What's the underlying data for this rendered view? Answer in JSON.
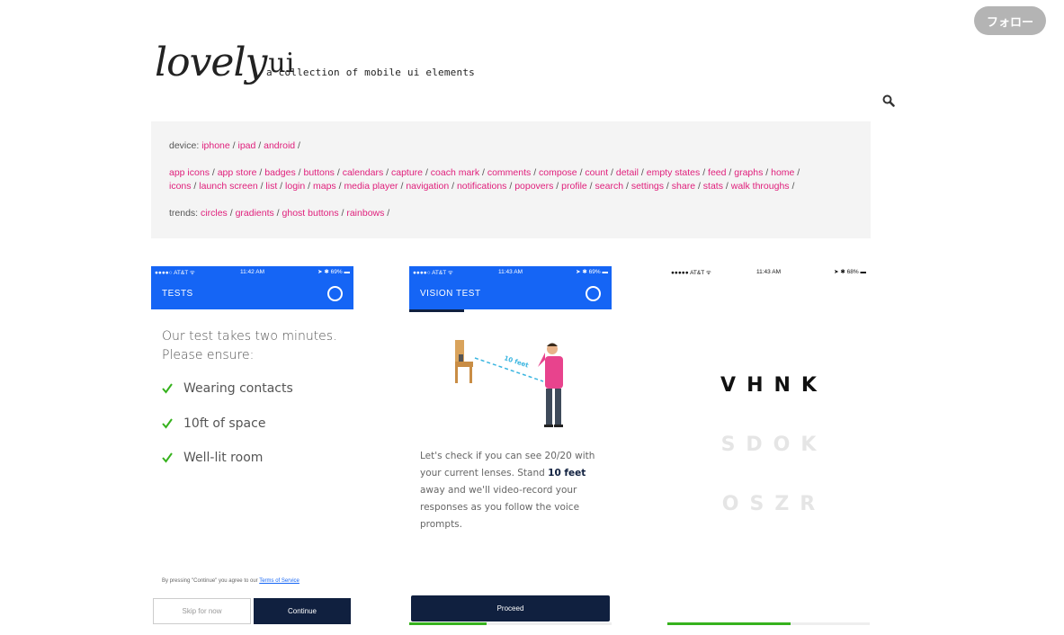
{
  "header": {
    "follow_label": "フォロー",
    "logo_lovely": "lovely",
    "logo_ui": "ui",
    "tagline": "a collection of mobile ui elements"
  },
  "filters": {
    "device_label": "device:",
    "devices": [
      "iphone",
      "ipad",
      "android"
    ],
    "categories_line1": [
      "app icons",
      "app store",
      "badges",
      "buttons",
      "calendars",
      "capture",
      "coach mark",
      "comments",
      "compose",
      "count",
      "detail",
      "empty states",
      "feed",
      "graphs",
      "home"
    ],
    "categories_line2": [
      "icons",
      "launch screen",
      "list",
      "login",
      "maps",
      "media player",
      "navigation",
      "notifications",
      "popovers",
      "profile",
      "search",
      "settings",
      "share",
      "stats",
      "walk throughs"
    ],
    "trends_label": "trends:",
    "trends": [
      "circles",
      "gradients",
      "ghost buttons",
      "rainbows"
    ]
  },
  "cards": {
    "tests": {
      "status_left": "●●●●○ AT&T ᯤ",
      "status_time": "11:42 AM",
      "status_right": "➤ ✱ 69% ▬",
      "title": "TESTS",
      "intro_line1": "Our test takes two minutes.",
      "intro_line2": "Please ensure:",
      "checklist": [
        "Wearing contacts",
        "10ft of space",
        "Well-lit room"
      ],
      "tos_prefix": "By pressing \"Continue\" you agree to our ",
      "tos_link": "Terms of Service",
      "skip_label": "Skip for now",
      "continue_label": "Continue"
    },
    "vision": {
      "status_left": "●●●●○ AT&T ᯤ",
      "status_time": "11:43 AM",
      "status_right": "➤ ✱ 69% ▬",
      "title": "VISION TEST",
      "distance_label": "10 feet",
      "text_before": "Let's check if you can see 20/20 with your current lenses. Stand ",
      "text_bold": "10 feet",
      "text_after": " away and we'll video-record your responses as you follow the voice prompts.",
      "proceed_label": "Proceed",
      "progress": 0.38
    },
    "chart": {
      "status_left": "●●●●● AT&T ᯤ",
      "status_time": "11:43 AM",
      "status_right": "➤ ✱ 68% ▬",
      "row1": "VHNK",
      "row2": "SDOK",
      "row3": "OSZR",
      "progress": 0.61
    }
  },
  "colors": {
    "accent_pink": "#e0207c",
    "app_blue": "#1565f5",
    "navy": "#10203f",
    "check_green": "#36b21d"
  }
}
